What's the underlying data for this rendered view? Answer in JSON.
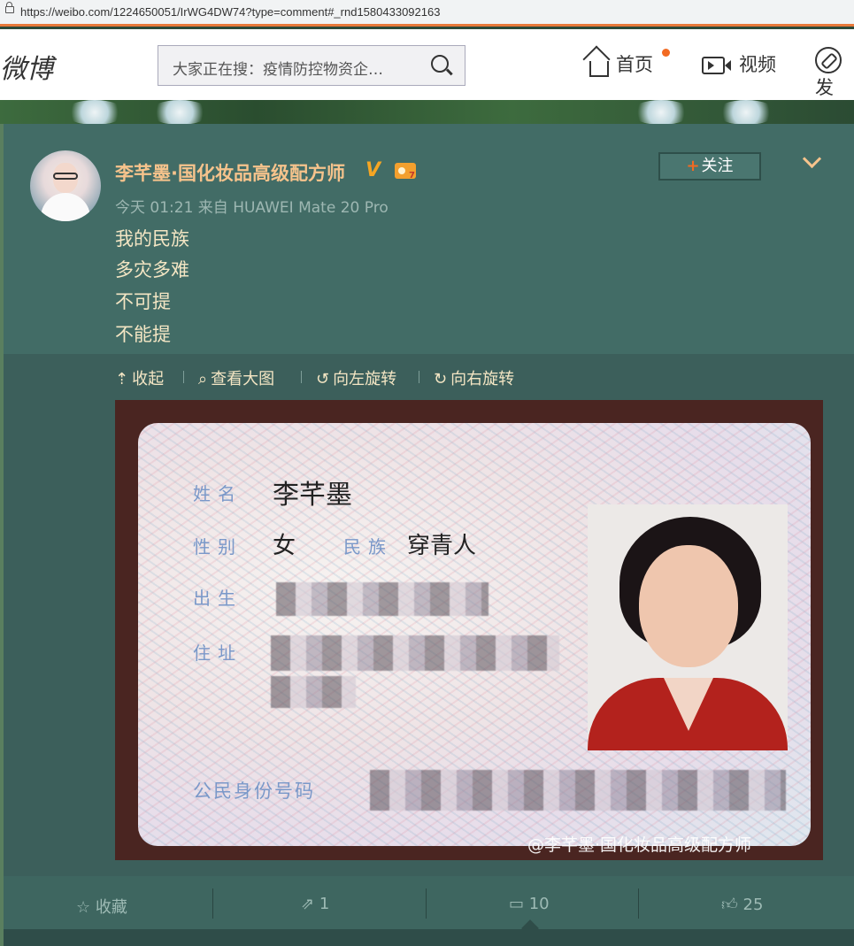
{
  "browser": {
    "url": "https://weibo.com/1224650051/IrWG4DW74?type=comment#_rnd1580433092163"
  },
  "header": {
    "logo": "微博",
    "search_placeholder": "大家正在搜：疫情防控物资企…",
    "nav": [
      {
        "label": "首页",
        "icon": "home-icon"
      },
      {
        "label": "视频",
        "icon": "video-icon"
      },
      {
        "label": "发",
        "icon": "compass-icon"
      }
    ]
  },
  "post": {
    "author": "李芊墨·国化妆品高级配方师",
    "verified_badge": "V",
    "time_source": "今天 01:21 来自 HUAWEI Mate 20 Pro",
    "follow_label": "关注",
    "follow_plus": "+",
    "lines": [
      "我的民族",
      "多灾多难",
      "不可提",
      "不能提"
    ],
    "media_tools": [
      {
        "label": "收起",
        "icon": "collapse-icon",
        "glyph": "⇡"
      },
      {
        "label": "查看大图",
        "icon": "zoom-icon",
        "glyph": "⌕"
      },
      {
        "label": "向左旋转",
        "icon": "rotate-left-icon",
        "glyph": "↺"
      },
      {
        "label": "向右旋转",
        "icon": "rotate-right-icon",
        "glyph": "↻"
      }
    ],
    "id_card": {
      "name_label": "姓名",
      "name_value": "李芊墨",
      "gender_label": "性别",
      "gender_value": "女",
      "ethnicity_label": "民族",
      "ethnicity_value": "穿青人",
      "birth_label": "出生",
      "address_label": "住址",
      "id_label": "公民身份号码",
      "watermark": "@李芊墨·国化妆品高级配方师"
    },
    "actions": {
      "favorite": "收藏",
      "repost_count": "1",
      "comment_count": "10",
      "like_count": "25"
    }
  },
  "colors": {
    "accent": "#f26a22",
    "card_bg": "#426c66",
    "name_color": "#f6c38c"
  }
}
